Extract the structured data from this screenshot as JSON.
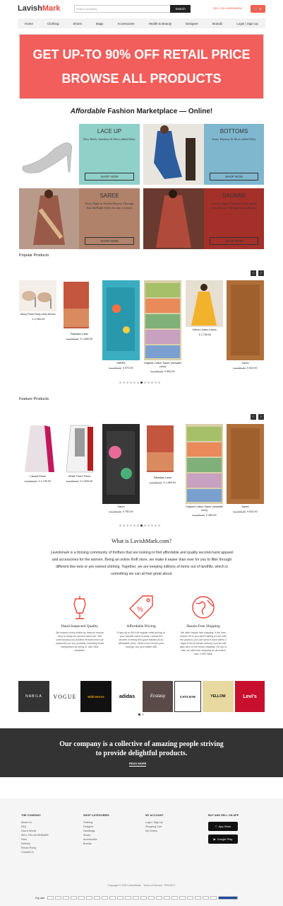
{
  "header": {
    "logo_a": "Lavish",
    "logo_b": "Mark",
    "search_placeholder": "Search products...",
    "search_button": "Search",
    "sell_link": "SELL ON LAVISHMARK",
    "cart_count": "0"
  },
  "nav": [
    "Home",
    "Clothing",
    "Shoes",
    "Bags",
    "Accessories",
    "Health & Beauty",
    "Designer",
    "Brands",
    "Login | Sign Up"
  ],
  "banner": {
    "line1": "GET UP-TO 90% OFF RETAIL PRICE",
    "line2": "BROWSE ALL PRODUCTS"
  },
  "tagline": {
    "italic": "Affordable",
    "rest": " Fashion Marketplace — Online!"
  },
  "categories": [
    {
      "title": "LACE UP",
      "desc": "New Heels, Sneakers & More added Daily",
      "button": "SHOP NOW"
    },
    {
      "title": "BOTTOMS",
      "desc": "Jeans, Pajamas & More added Daily",
      "button": "SHOP NOW"
    },
    {
      "title": "SAREE",
      "desc": "Party Night or Festive Browse Through Just the Right Styles for any occasion",
      "button": "SHOP NOW"
    },
    {
      "title": "SALWAR",
      "desc": "A wide range of salwars at our online store. Browse Through our collection",
      "button": "SHOP NOW"
    }
  ],
  "popular": {
    "title": "Popular Products",
    "products": [
      {
        "name": "Shiny Pearl Party Heel Shoes",
        "old": "",
        "price": "৳ 2,000.00"
      },
      {
        "name": "Pakistani Lawn",
        "old": "৳ 2,000.00",
        "price": "৳ 1,660.00"
      },
      {
        "name": "SAREE",
        "old": "৳ 1,050.00",
        "price": "৳ 970.00"
      },
      {
        "name": "Original Cotton Saree (versatile color)",
        "old": "৳ 1,050.00",
        "price": "৳ 500.00"
      },
      {
        "name": "Yellow Cotton Kamiz",
        "old": "",
        "price": "৳ 1,700.00"
      },
      {
        "name": "Saree",
        "old": "৳ 1,000.00",
        "price": "৳ 810.00"
      }
    ]
  },
  "feature": {
    "title": "Feature Products",
    "products": [
      {
        "name": "Casual Dress",
        "old": "৳ 2,000.00",
        "price": "৳ 1,700.00"
      },
      {
        "name": "White Three Piece",
        "old": "৳ 3,000.00",
        "price": "৳ 2,500.00"
      },
      {
        "name": "Saree",
        "old": "৳ 1,000.00",
        "price": "৳ 750.00"
      },
      {
        "name": "Pakistani Lawn",
        "old": "৳ 2,000.00",
        "price": "৳ 1,660.00"
      },
      {
        "name": "Original Cotton Saree (versatile color)",
        "old": "৳ 1,050.00",
        "price": "৳ 450.00"
      },
      {
        "name": "Saree",
        "old": "৳ 1,000.00",
        "price": "৳ 810.00"
      }
    ]
  },
  "about": {
    "title": "What is LavishMark.com?",
    "text": "Lavishmark is a thriving community of thrifters that are looking to find affordable and quality second-hand apparel and accessories for the women. Being an online thrift store, we make it easier than ever for you to filter through different like-new or pre-owned clothing. Together, we are keeping millions of items out of landfills, which is something we can all feel great about."
  },
  "features": [
    {
      "title": "Hand Inspected Quality",
      "text": "We inspect every article by hand to ensure they're ready for second hand use. We continuously use positive reviews from our customers on our products, including those categorized as being in 'Like New' condition."
    },
    {
      "title": "Affordable Pricing",
      "text": "Enjoy up to 90% off regular retail pricing of your favorite name brands. Unlock the secrets of being feel good fashion at an affordable price. Others won't know your savings, but your wallet will!"
    },
    {
      "title": "Hassle-Free Shipping",
      "text": "We offer hassle free shipping. If the item doesn't fit or you aren't falling in love with the product, you can send it back within 2 days of the products delivery and we will take care of the return shipping. On top of that, we offer free shipping on all orders over 2,000 Taka!"
    }
  ],
  "brands": [
    "NABILA",
    "VOGUE",
    "Wild Horse",
    "adidas",
    "Ecstasy",
    "CATS EYE",
    "YELLOW",
    "Levi's"
  ],
  "company": {
    "line1": "Our company is a collective of amazing people striving",
    "line2": "to provide delightful products.",
    "button": "READ MORE"
  },
  "footer": {
    "col1": {
      "title": "THE COMPANY",
      "items": [
        "About Us",
        "FAQ",
        "How It Works",
        "SELL ON LAVISHMARK",
        "Fees",
        "Delivery",
        "Return Policy",
        "Contact Us"
      ]
    },
    "col2": {
      "title": "SHOP CATEGORIES",
      "items": [
        "Clothing",
        "Designer",
        "Handbags",
        "Shoes",
        "Accessories",
        "Brands"
      ]
    },
    "col3": {
      "title": "MY ACCOUNT",
      "items": [
        "Login / Sign Up",
        "Shopping Cart",
        "My Orders"
      ]
    },
    "col4": {
      "title": "BUY AND SELL ON APP",
      "app_store": "App Store",
      "google_play": "Google Play"
    },
    "copyright": "Copyright © 2020 LavishMark  ·  Terms of Service  ·  PRIVACY",
    "pay_label": "Pay with"
  }
}
